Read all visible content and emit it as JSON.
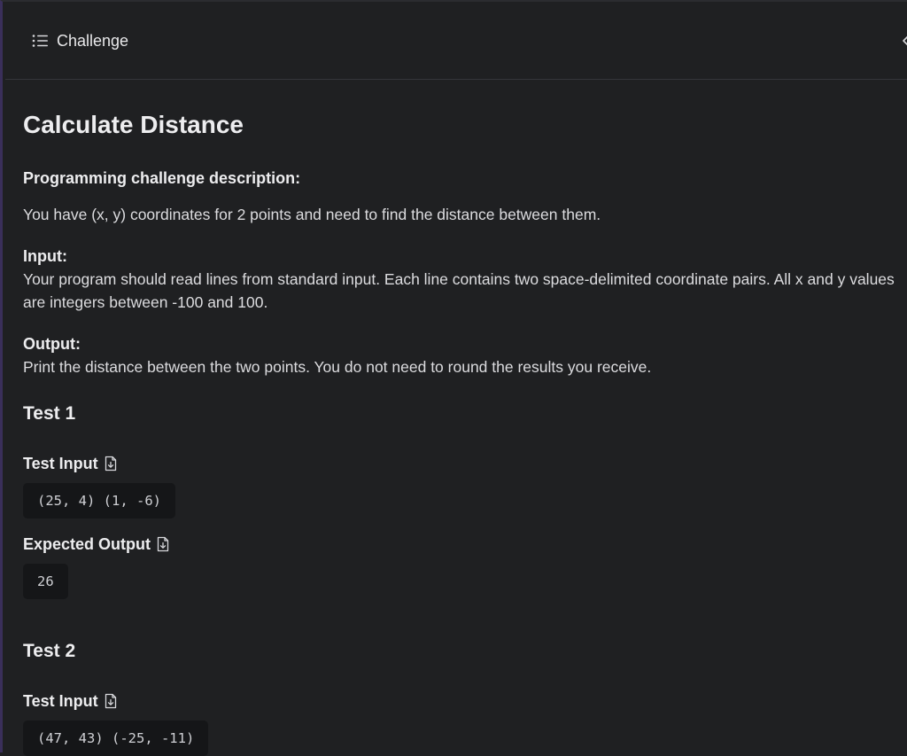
{
  "header": {
    "title": "Challenge",
    "icon": "list-icon",
    "collapse_icon": "chevron-left-icon"
  },
  "challenge": {
    "title": "Calculate Distance",
    "description_label": "Programming challenge description:",
    "description": "You have (x, y) coordinates for 2 points and need to find the distance between them.",
    "input_label": "Input:",
    "input_text": "Your program should read lines from standard input. Each line contains two space-delimited coordinate pairs. All x and y values are integers between -100 and 100.",
    "output_label": "Output:",
    "output_text": "Print the distance between the two points. You do not need to round the results you receive."
  },
  "tests": [
    {
      "heading": "Test 1",
      "input_label": "Test Input",
      "input": "(25, 4) (1, -6)",
      "output_label": "Expected Output",
      "output": "26"
    },
    {
      "heading": "Test 2",
      "input_label": "Test Input",
      "input": "(47, 43) (-25, -11)"
    }
  ],
  "colors": {
    "background": "#1f2022",
    "code_background": "#151618",
    "accent_border": "#3a2f5a"
  }
}
